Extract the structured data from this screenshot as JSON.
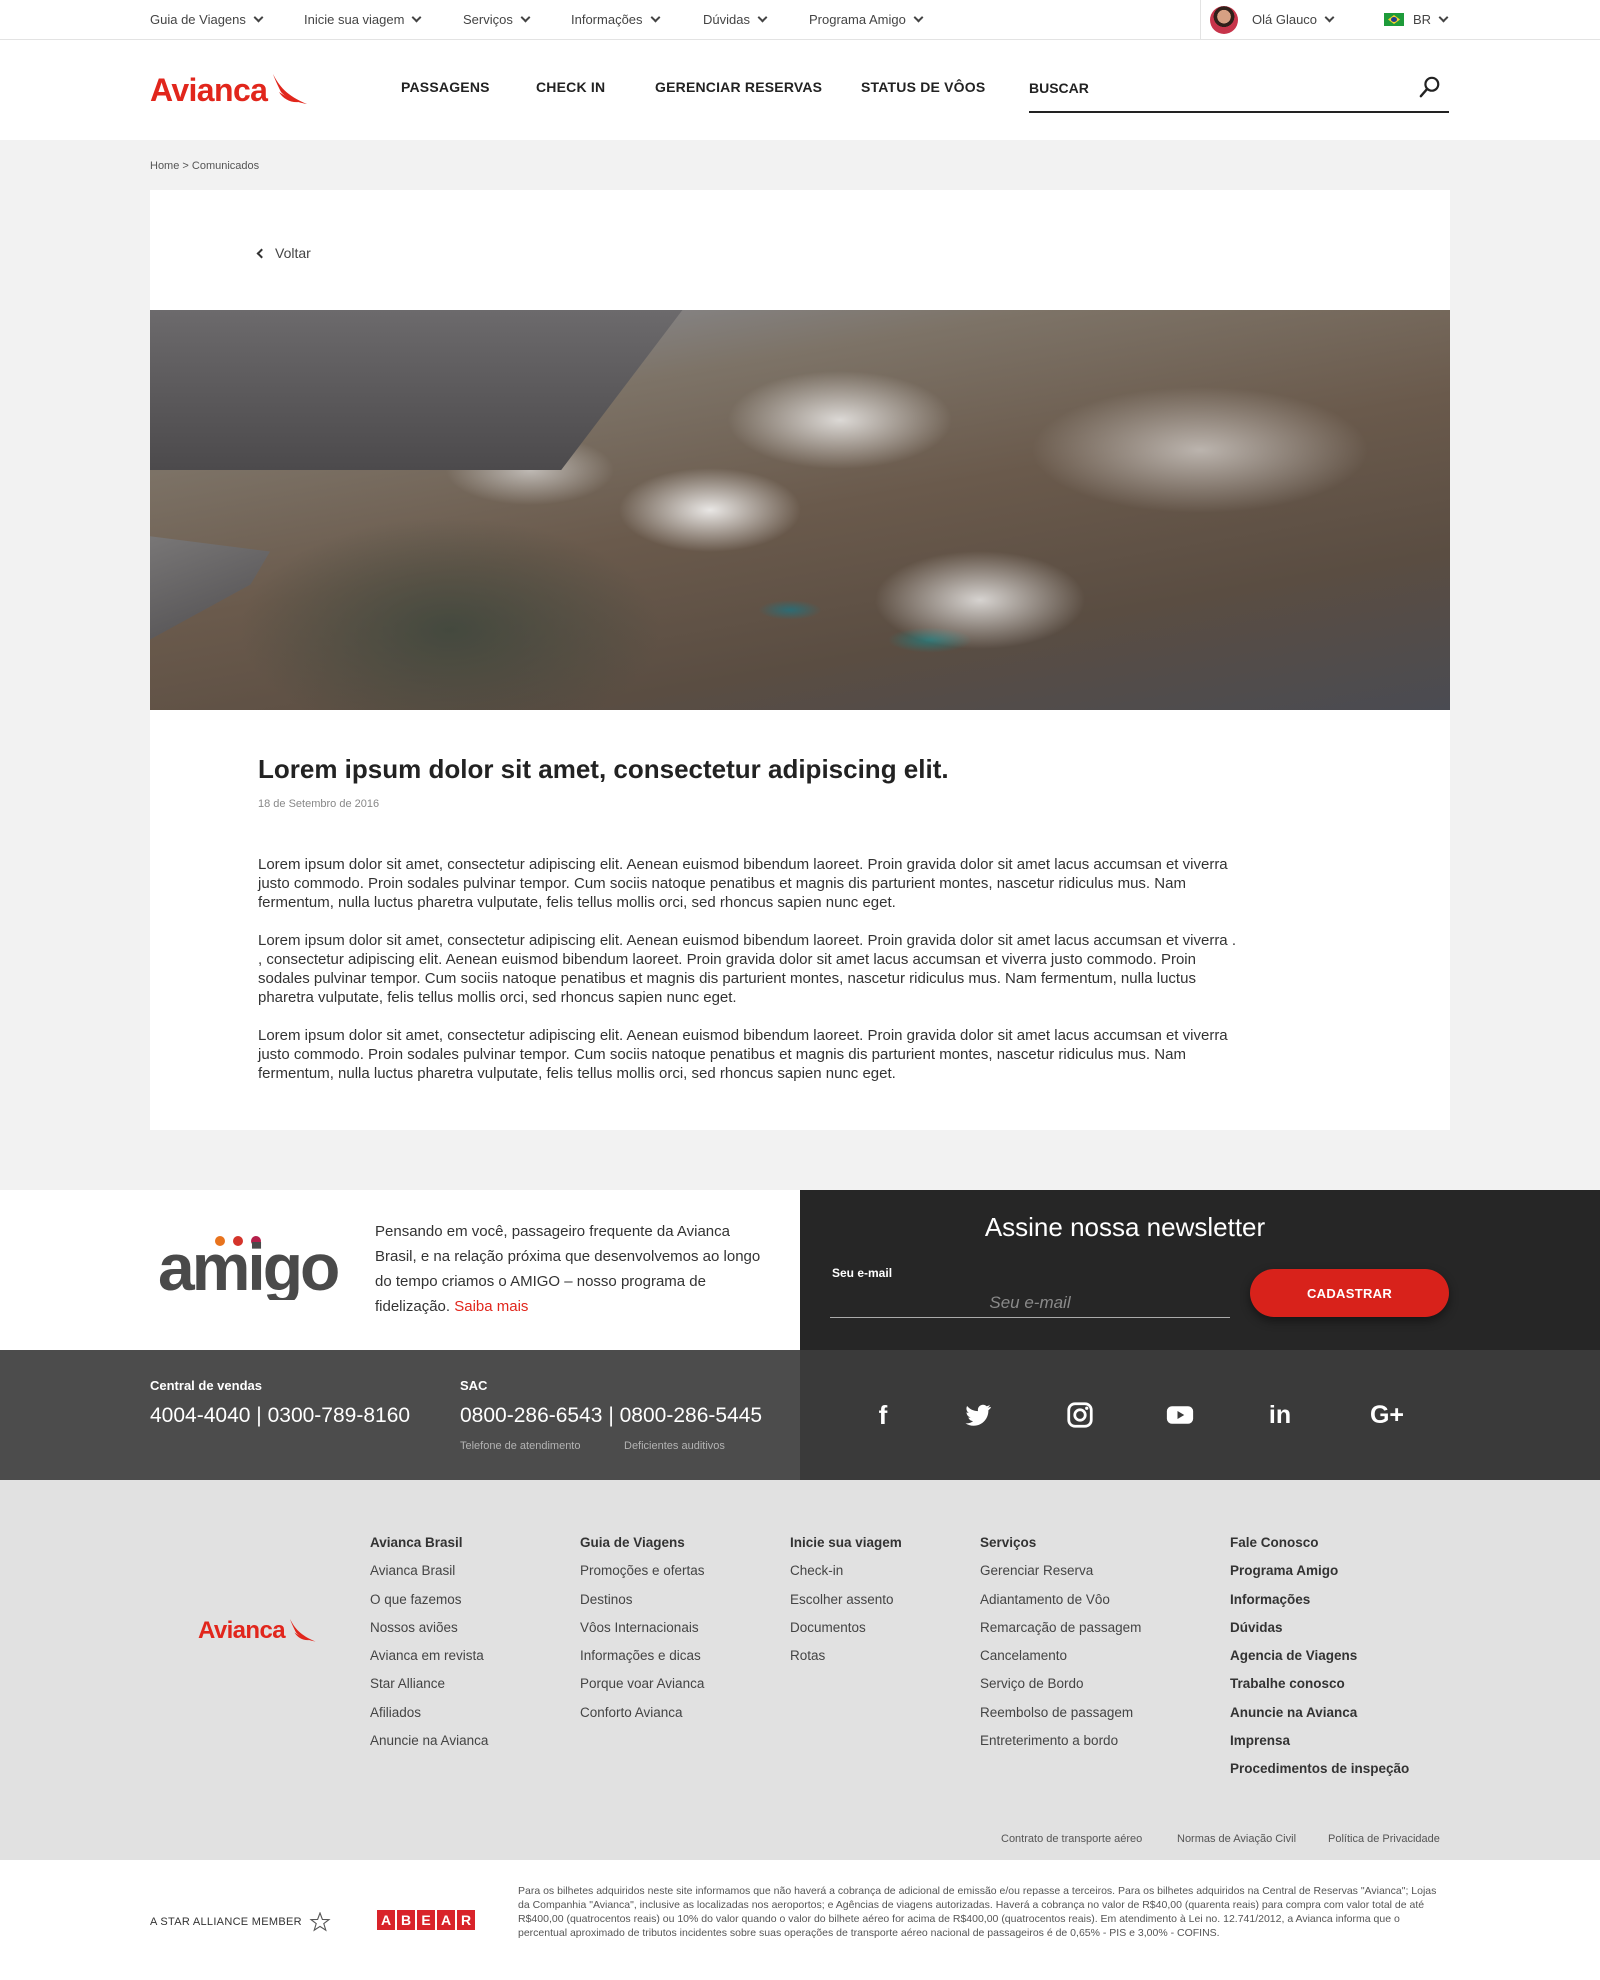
{
  "utility_nav": {
    "items": [
      {
        "label": "Guia de Viagens"
      },
      {
        "label": "Inicie sua viagem"
      },
      {
        "label": "Serviços"
      },
      {
        "label": "Informações"
      },
      {
        "label": "Dúvidas"
      },
      {
        "label": "Programa Amigo"
      }
    ],
    "user_greeting": "Olá Glauco",
    "language": "BR"
  },
  "header": {
    "logo_text": "Avianca",
    "nav": [
      {
        "label": "PASSAGENS"
      },
      {
        "label": "CHECK IN"
      },
      {
        "label": "GERENCIAR RESERVAS"
      },
      {
        "label": "STATUS DE VÔOS"
      }
    ],
    "search_label": "BUSCAR"
  },
  "breadcrumb": "Home > Comunicados",
  "article": {
    "back_label": "Voltar",
    "title": "Lorem ipsum dolor sit amet, consectetur adipiscing elit.",
    "date": "18 de Setembro de 2016",
    "paragraphs": [
      "Lorem ipsum dolor sit amet, consectetur adipiscing elit. Aenean euismod bibendum laoreet. Proin gravida dolor sit amet lacus accumsan et viverra justo commodo. Proin sodales pulvinar tempor. Cum sociis natoque penatibus et magnis dis parturient montes, nascetur ridiculus mus. Nam fermentum, nulla luctus pharetra vulputate, felis tellus mollis orci, sed rhoncus sapien nunc eget.",
      "Lorem ipsum dolor sit amet, consectetur adipiscing elit. Aenean euismod bibendum laoreet. Proin gravida dolor sit amet lacus accumsan et viverra . , consectetur adipiscing elit. Aenean euismod bibendum laoreet. Proin gravida dolor sit amet lacus accumsan et viverra justo commodo. Proin sodales pulvinar tempor. Cum sociis natoque penatibus et magnis dis parturient montes, nascetur ridiculus mus. Nam fermentum, nulla luctus pharetra vulputate, felis tellus mollis orci, sed rhoncus sapien nunc eget.",
      "Lorem ipsum dolor sit amet, consectetur adipiscing elit. Aenean euismod bibendum laoreet. Proin gravida dolor sit amet lacus accumsan et viverra justo commodo. Proin sodales pulvinar tempor. Cum sociis natoque penatibus et magnis dis parturient montes, nascetur ridiculus mus. Nam fermentum, nulla luctus pharetra vulputate, felis tellus mollis orci, sed rhoncus sapien nunc eget."
    ]
  },
  "amigo": {
    "logo_text": "amigo",
    "text": "Pensando em você, passageiro frequente da Avianca Brasil, e na relação próxima que desenvolvemos ao longo do tempo criamos o AMIGO – nosso programa de fidelização.",
    "link_label": "Saiba mais"
  },
  "newsletter": {
    "title": "Assine nossa newsletter",
    "email_label": "Seu e-mail",
    "email_placeholder": "Seu e-mail",
    "button_label": "CADASTRAR"
  },
  "contact": {
    "sales_label": "Central de vendas",
    "sales_phone_1": "4004-4040",
    "sales_phone_2": "0300-789-8160",
    "sac_label": "SAC",
    "sac_phone_1": "0800-286-6543",
    "sac_phone_2": "0800-286-5445",
    "sac_sub_1": "Telefone de atendimento",
    "sac_sub_2": "Deficientes auditivos",
    "separator": "|"
  },
  "social": [
    {
      "icon": "facebook-icon",
      "glyph": "f"
    },
    {
      "icon": "twitter-icon",
      "glyph": ""
    },
    {
      "icon": "instagram-icon",
      "glyph": ""
    },
    {
      "icon": "youtube-icon",
      "glyph": ""
    },
    {
      "icon": "linkedin-icon",
      "glyph": "in"
    },
    {
      "icon": "google-plus-icon",
      "glyph": "G+"
    }
  ],
  "footer": {
    "logo_text": "Avianca",
    "columns": [
      {
        "head": "Avianca Brasil",
        "items": [
          "Avianca Brasil",
          "O que fazemos",
          "Nossos aviões",
          "Avianca em revista",
          "Star Alliance",
          "Afiliados",
          "Anuncie na Avianca"
        ]
      },
      {
        "head": "Guia de Viagens",
        "items": [
          "Promoções e ofertas",
          "Destinos",
          "Vôos Internacionais",
          "Informações e dicas",
          "Porque voar Avianca",
          "Conforto Avianca"
        ]
      },
      {
        "head": "Inicie sua viagem",
        "items": [
          "Check-in",
          "Escolher assento",
          "Documentos",
          "Rotas"
        ]
      },
      {
        "head": "Serviços",
        "items": [
          "Gerenciar Reserva",
          "Adiantamento de Vôo",
          "Remarcação de passagem",
          "Cancelamento",
          "Serviço de Bordo",
          "Reembolso de passagem",
          "Entreterimento a bordo"
        ]
      },
      {
        "head": "Fale Conosco",
        "items": [
          "Programa Amigo",
          "Informações",
          "Dúvidas",
          "Agencia de Viagens",
          "Trabalhe conosco",
          "Anuncie na Avianca",
          "Imprensa",
          "Procedimentos de inspeção"
        ]
      }
    ],
    "legal_links": [
      "Contrato de transporte aéreo",
      "Normas de Aviação Civil",
      "Política de Privacidade"
    ]
  },
  "bottom": {
    "star_alliance": "A STAR ALLIANCE MEMBER",
    "abear_letters": [
      "A",
      "B",
      "E",
      "A",
      "R"
    ],
    "disclaimer": "Para os bilhetes adquiridos neste site informamos que não haverá a cobrança de adicional de emissão e/ou repasse a terceiros. Para os bilhetes adquiridos na Central de Reservas \"Avianca\"; Lojas da Companhia \"Avianca\", inclusive as localizadas nos aeroportos; e Agências de viagens autorizadas. Haverá a cobrança no valor de R$40,00 (quarenta reais) para compra com valor total de até R$400,00 (quatrocentos reais) ou 10% do valor quando o valor do bilhete aéreo for acima de R$400,00 (quatrocentos reais). Em atendimento à Lei no. 12.741/2012, a Avianca informa que o percentual aproximado de tributos incidentes sobre suas operações de transporte aéreo nacional de passageiros é de 0,65% - PIS e 3,00% - COFINS."
  },
  "colors": {
    "brand_red": "#e1261c",
    "button_red": "#d8221b",
    "newsletter_bg": "#262626",
    "contact_bg": "#4c4c4c",
    "social_bg": "#3a3a3a",
    "footer_bg": "#e1e1e1"
  }
}
